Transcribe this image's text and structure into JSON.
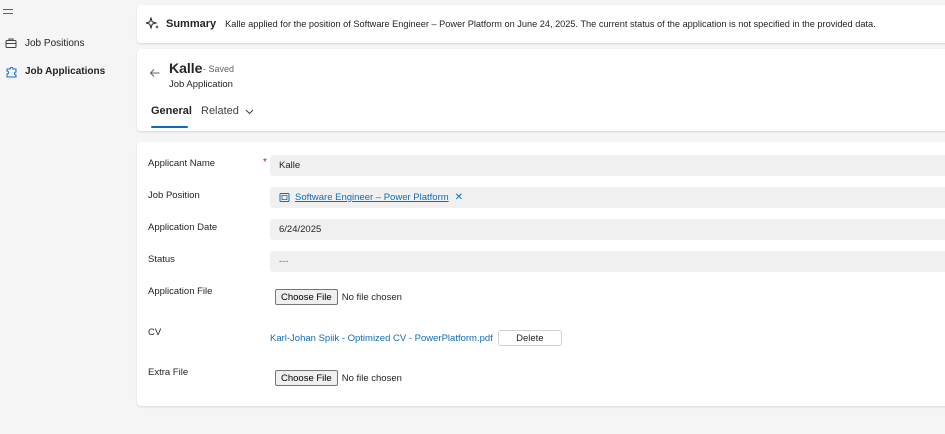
{
  "sidebar": {
    "items": [
      {
        "label": "Job Positions",
        "icon": "briefcase-icon"
      },
      {
        "label": "Job Applications",
        "icon": "puzzle-icon"
      }
    ]
  },
  "summary": {
    "title": "Summary",
    "text": "Kalle applied for the position of Software Engineer – Power Platform on June 24, 2025. The current status of the application is not specified in the provided data."
  },
  "header": {
    "name": "Kalle",
    "status": "- Saved",
    "entity": "Job Application",
    "tabs": [
      {
        "label": "General",
        "active": true
      },
      {
        "label": "Related",
        "active": false
      }
    ]
  },
  "form": {
    "applicant_name": {
      "label": "Applicant Name",
      "required_mark": "*",
      "value": "Kalle"
    },
    "job_position": {
      "label": "Job Position",
      "value": "Software Engineer – Power Platform",
      "remove": "✕"
    },
    "application_date": {
      "label": "Application Date",
      "value": "6/24/2025"
    },
    "status": {
      "label": "Status",
      "value": "---"
    },
    "application_file": {
      "label": "Application File",
      "button": "Choose File",
      "none": "No file chosen"
    },
    "cv": {
      "label": "CV",
      "file_name": "Karl-Johan Spiik - Optimized CV - PowerPlatform.pdf",
      "delete": "Delete"
    },
    "extra_file": {
      "label": "Extra File",
      "button": "Choose File",
      "none": "No file chosen"
    }
  },
  "colors": {
    "accent": "#0f6cbd",
    "required": "#c50f1f",
    "background": "#f5f5f5",
    "field_bg": "#f0f0f0"
  }
}
